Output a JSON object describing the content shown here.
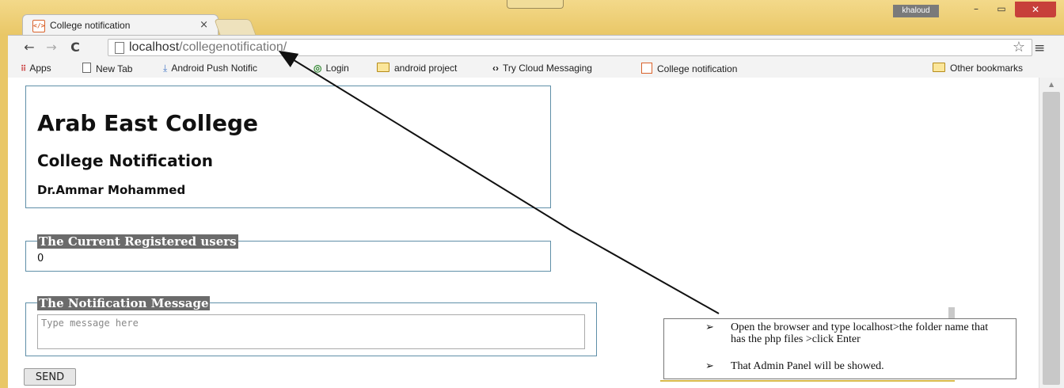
{
  "browser": {
    "tab_title": "College notification",
    "tab_close": "×",
    "user_badge": "khaloud",
    "window_controls": {
      "minimize": "–",
      "maximize": "▭",
      "close": "✕"
    },
    "nav": {
      "back": "←",
      "forward": "→",
      "reload": "C"
    },
    "url_host": "localhost",
    "url_path": "/collegenotification/",
    "star": "☆",
    "menu": "≡"
  },
  "bookmarks": [
    {
      "label": "Apps",
      "icon": "apps-grid-icon"
    },
    {
      "label": "New Tab",
      "icon": "page-icon"
    },
    {
      "label": "Android Push Notific",
      "icon": "download-icon"
    },
    {
      "label": "Login",
      "icon": "chrome-icon"
    },
    {
      "label": "android project",
      "icon": "folder-icon"
    },
    {
      "label": "Try Cloud Messaging",
      "icon": "code-icon"
    },
    {
      "label": "College notification",
      "icon": "site-favicon"
    },
    {
      "label": "Other bookmarks",
      "icon": "folder-icon"
    }
  ],
  "page": {
    "college_name": "Arab East College",
    "subtitle": "College Notification",
    "author": "Dr.Ammar Mohammed",
    "users_legend": "The Current Registered users",
    "users_count": "0",
    "message_legend": "The Notification Message",
    "message_placeholder": "Type message here",
    "send_label": "SEND"
  },
  "annotation": {
    "bullet": "➢",
    "step_1": "Open the browser and type localhost>the folder name that has the php files >click Enter",
    "step_2": "That Admin Panel will be showed."
  },
  "colors": {
    "frame": "#e9c767",
    "border_accent": "#5f8fa8",
    "legend_bg": "#6b6b6b",
    "close_red": "#c7403a"
  }
}
